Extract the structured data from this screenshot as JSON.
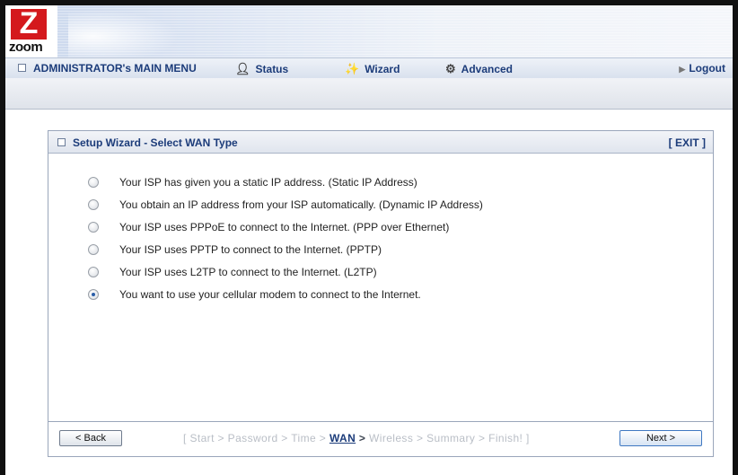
{
  "logo": {
    "letter": "Z",
    "text": "zoom"
  },
  "menu": {
    "admin": "ADMINISTRATOR's MAIN MENU",
    "items": [
      {
        "label": "Status",
        "icon": "person-icon"
      },
      {
        "label": "Wizard",
        "icon": "wand-icon"
      },
      {
        "label": "Advanced",
        "icon": "toolbox-icon"
      }
    ],
    "logout": "Logout"
  },
  "panel": {
    "title": "Setup Wizard - Select WAN Type",
    "exit": "[ EXIT ]",
    "options": [
      {
        "label": "Your ISP has given you a static IP address. (Static IP Address)",
        "checked": false
      },
      {
        "label": "You obtain an IP address from your ISP automatically. (Dynamic IP Address)",
        "checked": false
      },
      {
        "label": "Your ISP uses PPPoE to connect to the Internet. (PPP over Ethernet)",
        "checked": false
      },
      {
        "label": "Your ISP uses PPTP to connect to the Internet. (PPTP)",
        "checked": false
      },
      {
        "label": "Your ISP uses L2TP to connect to the Internet. (L2TP)",
        "checked": false
      },
      {
        "label": "You want to use your cellular modem to connect to the Internet.",
        "checked": true
      }
    ],
    "footer": {
      "back": "< Back",
      "next": "Next >",
      "steps_before": "[ Start > Password > Time > ",
      "steps_current": "WAN",
      "steps_gt": " > ",
      "steps_after": "Wireless > Summary > Finish! ]"
    }
  }
}
